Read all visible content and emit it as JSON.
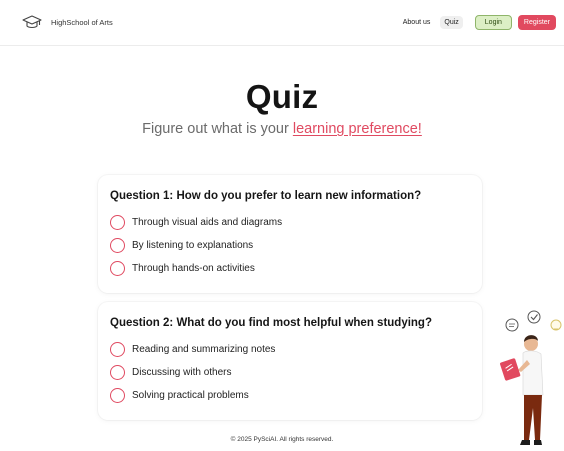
{
  "nav": {
    "brand": "HighSchool of Arts",
    "links": [
      {
        "label": "About us"
      },
      {
        "label": "Quiz"
      }
    ],
    "login_label": "Login",
    "register_label": "Register"
  },
  "hero": {
    "title": "Quiz",
    "subtitle_prefix": "Figure out what is your ",
    "subtitle_link": "learning preference!"
  },
  "questions": [
    {
      "text": "Question 1: How do you prefer to learn new information?",
      "options": [
        "Through visual aids and diagrams",
        "By listening to explanations",
        "Through hands-on activities"
      ]
    },
    {
      "text": "Question 2: What do you find most helpful when studying?",
      "options": [
        "Reading and summarizing notes",
        "Discussing with others",
        "Solving practical problems"
      ]
    }
  ],
  "footer": {
    "text": "© 2025 PySciAI. All rights reserved."
  },
  "icons": {
    "brand": "graduation-cap-icon",
    "illustration": "student-reading-illustration"
  },
  "colors": {
    "accent": "#e04a61",
    "login_bg": "#dcefc5",
    "login_border": "#8fb56a"
  }
}
